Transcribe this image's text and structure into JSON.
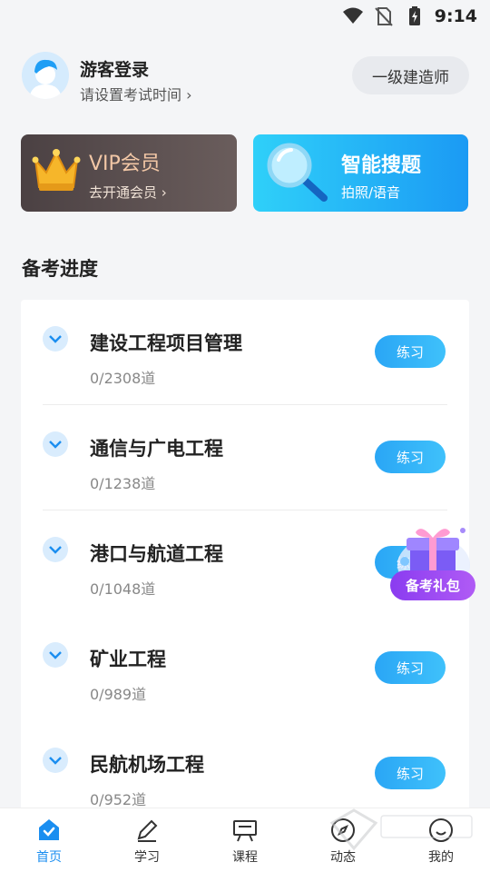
{
  "status_bar": {
    "time": "9:14"
  },
  "header": {
    "user_name": "游客登录",
    "user_sub": "请设置考试时间 ›",
    "level_button": "一级建造师"
  },
  "promos": {
    "vip_title": "VIP会员",
    "vip_sub": "去开通会员 ›",
    "search_title": "智能搜题",
    "search_sub": "拍照/语音"
  },
  "section_title": "备考进度",
  "progress": {
    "items": [
      {
        "title": "建设工程项目管理",
        "count": "0/2308道",
        "button": "练习"
      },
      {
        "title": "通信与广电工程",
        "count": "0/1238道",
        "button": "练习"
      },
      {
        "title": "港口与航道工程",
        "count": "0/1048道",
        "button": "练习"
      },
      {
        "title": "矿业工程",
        "count": "0/989道",
        "button": "练习"
      },
      {
        "title": "民航机场工程",
        "count": "0/952道",
        "button": "练习"
      }
    ]
  },
  "floating_gift": {
    "label": "备考礼包"
  },
  "bottom_nav": {
    "items": [
      {
        "label": "首页",
        "icon": "home-icon",
        "active": true
      },
      {
        "label": "学习",
        "icon": "pen-icon",
        "active": false
      },
      {
        "label": "课程",
        "icon": "board-icon",
        "active": false
      },
      {
        "label": "动态",
        "icon": "compass-icon",
        "active": false
      },
      {
        "label": "我的",
        "icon": "user-icon",
        "active": false
      }
    ]
  },
  "colors": {
    "accent": "#1b8ef0",
    "vip_gold": "#f2c7a6",
    "gift_purple": "#8a3cf0"
  }
}
